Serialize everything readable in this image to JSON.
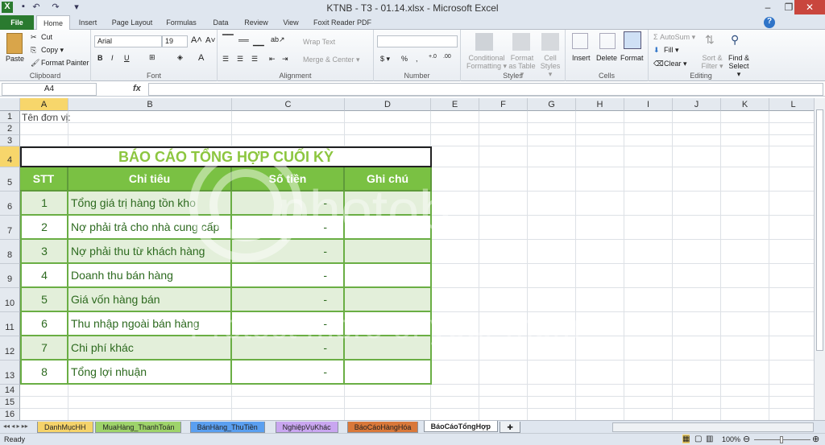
{
  "window": {
    "title": "KTNB - T3 - 01.14.xlsx  -  Microsoft Excel",
    "controls": [
      "–",
      "❐",
      "✕"
    ]
  },
  "ribbon_tabs": [
    "File",
    "Home",
    "Insert",
    "Page Layout",
    "Formulas",
    "Data",
    "Review",
    "View",
    "Foxit Reader PDF"
  ],
  "clipboard": {
    "paste": "Paste",
    "cut": "Cut",
    "copy": "Copy ▾",
    "format_painter": "Format Painter",
    "label": "Clipboard"
  },
  "font": {
    "name": "Arial",
    "size": "19",
    "label": "Font"
  },
  "alignment": {
    "wrap": "Wrap Text",
    "merge": "Merge & Center ▾",
    "label": "Alignment"
  },
  "number": {
    "format": "",
    "label": "Number"
  },
  "styles": {
    "conditional": "Conditional Formatting ▾",
    "table": "Format as Table ▾",
    "cell": "Cell Styles ▾",
    "label": "Styles"
  },
  "cells": {
    "insert": "Insert",
    "delete": "Delete",
    "format": "Format",
    "label": "Cells"
  },
  "editing": {
    "autosum": "Σ AutoSum ▾",
    "fill": "Fill ▾",
    "clear": "Clear ▾",
    "sort": "Sort & Filter ▾",
    "find": "Find & Select ▾",
    "label": "Editing"
  },
  "formula_bar": {
    "name_box": "A4",
    "fx": "fx",
    "value": ""
  },
  "columns": [
    "A",
    "B",
    "C",
    "D",
    "E",
    "F",
    "G",
    "H",
    "I",
    "J",
    "K",
    "L"
  ],
  "rows": [
    "1",
    "2",
    "3",
    "4",
    "5",
    "6",
    "7",
    "8",
    "9",
    "10",
    "11",
    "12",
    "13",
    "14",
    "15",
    "16"
  ],
  "sheet": {
    "unit_label": "Tên đơn vị:",
    "title": "BÁO CÁO TỔNG HỢP CUỐI KỲ",
    "headers": [
      "STT",
      "Chỉ tiêu",
      "Số tiền",
      "Ghi chú"
    ],
    "items": [
      [
        "1",
        "Tổng giá trị hàng tồn kho",
        "-",
        ""
      ],
      [
        "2",
        "Nợ phải trả cho nhà cung cấp",
        "-",
        ""
      ],
      [
        "3",
        "Nợ phải thu từ khách hàng",
        "-",
        ""
      ],
      [
        "4",
        "Doanh thu bán hàng",
        "-",
        ""
      ],
      [
        "5",
        "Giá vốn hàng bán",
        "-",
        ""
      ],
      [
        "6",
        "Thu nhập ngoài bán hàng",
        "-",
        ""
      ],
      [
        "7",
        "Chi phí khác",
        "-",
        ""
      ],
      [
        "8",
        "Tổng lợi nhuận",
        "-",
        ""
      ]
    ]
  },
  "sheet_tabs": [
    {
      "name": "DanhMụcHH",
      "color": "#f5d36a"
    },
    {
      "name": "MuaHàng_ThanhToán",
      "color": "#9ed36a"
    },
    {
      "name": "BánHàng_ThuTiền",
      "color": "#5a9ff0"
    },
    {
      "name": "NghiệpVụKhác",
      "color": "#c9a6f0"
    },
    {
      "name": "BáoCáoHàngHóa",
      "color": "#d9783a"
    },
    {
      "name": "BáoCáoTổngHợp",
      "color": "#ffffff",
      "active": true
    }
  ],
  "status": {
    "ready": "Ready",
    "zoom": "100%"
  },
  "colors": {
    "header_green": "#7ac143",
    "title_green": "#8cc63f",
    "band": "#e3efda",
    "border": "#6aae44"
  }
}
